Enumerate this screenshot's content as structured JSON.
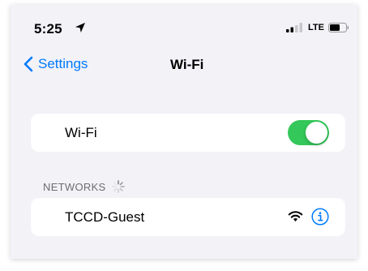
{
  "status_bar": {
    "time": "5:25",
    "network_type": "LTE",
    "icons": [
      "location-icon",
      "signal-icon",
      "battery-icon"
    ]
  },
  "nav": {
    "back_label": "Settings",
    "title": "Wi-Fi"
  },
  "wifi_toggle": {
    "label": "Wi-Fi",
    "state": "on",
    "accent_color": "#34c759"
  },
  "networks": {
    "header": "NETWORKS",
    "items": [
      {
        "name": "TCCD-Guest",
        "icons": [
          "wifi-signal-icon",
          "info-icon"
        ]
      }
    ]
  },
  "colors": {
    "link": "#007aff",
    "background": "#f2f2f7",
    "section_header": "#6d6d72"
  }
}
